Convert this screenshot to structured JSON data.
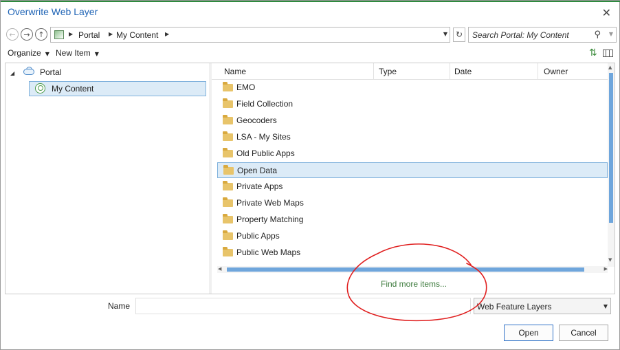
{
  "window": {
    "title": "Overwrite Web Layer",
    "close_glyph": "✕"
  },
  "nav": {
    "back_glyph": "←",
    "forward_glyph": "→",
    "up_glyph": "↑",
    "breadcrumb": [
      "Portal",
      "My Content"
    ],
    "refresh_glyph": "↻",
    "search_placeholder": "Search Portal: My Content"
  },
  "toolbar": {
    "organize_label": "Organize",
    "new_item_label": "New Item"
  },
  "tree": {
    "root_label": "Portal",
    "child_label": "My Content"
  },
  "list": {
    "columns": [
      "Name",
      "Type",
      "Date",
      "Owner"
    ],
    "items": [
      "EMO",
      "Field Collection",
      "Geocoders",
      "LSA - My Sites",
      "Old Public Apps",
      "Open Data",
      "Private Apps",
      "Private Web Maps",
      "Property Matching",
      "Public Apps",
      "Public Web Maps"
    ],
    "selected_item": "Open Data",
    "find_more_label": "Find more items..."
  },
  "footer": {
    "name_label": "Name",
    "name_value": "",
    "filetype_value": "Web Feature Layers",
    "open_label": "Open",
    "cancel_label": "Cancel"
  },
  "colors": {
    "accent_blue": "#1e63b5",
    "selection_bg": "#dcebf7",
    "selection_border": "#7fb1dc",
    "annotation_red": "#e01f1f",
    "link_green": "#3c7a3c"
  }
}
